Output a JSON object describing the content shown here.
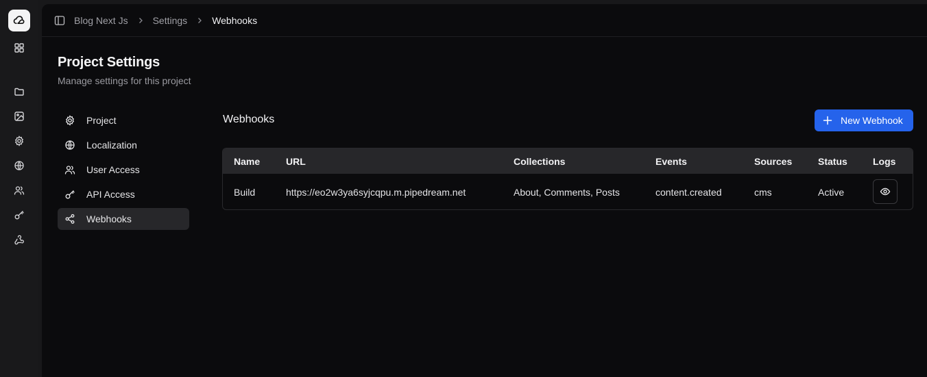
{
  "breadcrumb": [
    "Blog Next Js",
    "Settings",
    "Webhooks"
  ],
  "page": {
    "title": "Project Settings",
    "subtitle": "Manage settings for this project"
  },
  "settings_nav": [
    {
      "label": "Project",
      "icon": "gear-icon"
    },
    {
      "label": "Localization",
      "icon": "globe-icon"
    },
    {
      "label": "User Access",
      "icon": "users-icon"
    },
    {
      "label": "API Access",
      "icon": "key-icon"
    },
    {
      "label": "Webhooks",
      "icon": "share-icon",
      "active": true
    }
  ],
  "webhooks": {
    "title": "Webhooks",
    "new_button": "New Webhook",
    "columns": [
      "Name",
      "URL",
      "Collections",
      "Events",
      "Sources",
      "Status",
      "Logs"
    ],
    "rows": [
      {
        "name": "Build",
        "url": "https://eo2w3ya6syjcqpu.m.pipedream.net",
        "collections": "About, Comments, Posts",
        "events": "content.created",
        "sources": "cms",
        "status": "Active"
      }
    ]
  },
  "rail_icons": [
    "logo-icon",
    "grid-icon",
    "folder-icon",
    "image-icon",
    "gear-icon",
    "globe-icon",
    "users-icon",
    "key-icon",
    "webhook-icon"
  ],
  "colors": {
    "accent": "#2563eb",
    "background": "#0b0b0d",
    "active_nav": "#27272a"
  }
}
